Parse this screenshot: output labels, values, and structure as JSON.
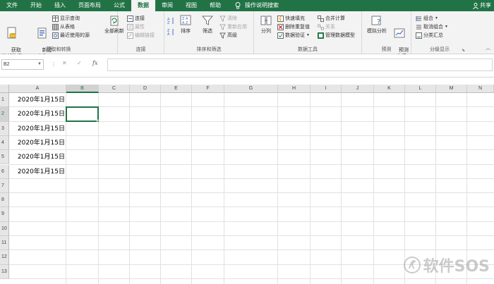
{
  "tabs": [
    {
      "label": "文件",
      "active": false
    },
    {
      "label": "开始",
      "active": false
    },
    {
      "label": "插入",
      "active": false
    },
    {
      "label": "页面布局",
      "active": false
    },
    {
      "label": "公式",
      "active": false
    },
    {
      "label": "数据",
      "active": true
    },
    {
      "label": "审阅",
      "active": false
    },
    {
      "label": "视图",
      "active": false
    },
    {
      "label": "帮助",
      "active": false
    }
  ],
  "tell_me": "操作说明搜索",
  "share": "共享",
  "ribbon": {
    "get_transform": {
      "get_external_data": "获取\n外部数据",
      "new_query": "新建\n查询",
      "show_queries": "显示查询",
      "from_table": "从表格",
      "recent_sources": "最近使用的源",
      "label": "获取和转换"
    },
    "connections": {
      "refresh_all": "全部刷新",
      "connections": "连接",
      "properties": "属性",
      "edit_links": "编辑链接",
      "label": "连接"
    },
    "sort_filter": {
      "sort": "排序",
      "filter": "筛选",
      "clear": "清除",
      "reapply": "重新应用",
      "advanced": "高级",
      "label": "排序和筛选"
    },
    "data_tools": {
      "text_to_columns": "分列",
      "flash_fill": "快速填充",
      "remove_duplicates": "删除重复值",
      "data_validation": "数据验证",
      "consolidate": "合并计算",
      "relationships": "关系",
      "manage_data_model": "管理数据模型",
      "label": "数据工具"
    },
    "forecast": {
      "what_if": "模拟分析",
      "forecast_sheet": "预测\n工作表",
      "label": "预测"
    },
    "outline": {
      "group": "组合",
      "ungroup": "取消组合",
      "subtotal": "分类汇总",
      "label": "分级显示"
    }
  },
  "name_box": "B2",
  "formula_icons": {
    "cancel": "✕",
    "enter": "✓",
    "fx": "fx"
  },
  "formula_value": "",
  "columns": [
    "A",
    "B",
    "C",
    "D",
    "E",
    "F",
    "G",
    "H",
    "I",
    "J",
    "K",
    "L",
    "M",
    "N"
  ],
  "selected_column": "B",
  "rows": [
    "1",
    "2",
    "3",
    "4",
    "5",
    "6",
    "7",
    "8",
    "9",
    "10",
    "11",
    "12",
    "13"
  ],
  "selected_row": "2",
  "cells_a": [
    "2020年1月15日",
    "2020年1月15日",
    "2020年1月15日",
    "2020年1月15日",
    "2020年1月15日",
    "2020年1月15日"
  ],
  "watermark": "软件SOS",
  "colors": {
    "accent": "#217346",
    "ribbon_bg": "#f3f3f3",
    "header_bg": "#e6e6e6"
  }
}
